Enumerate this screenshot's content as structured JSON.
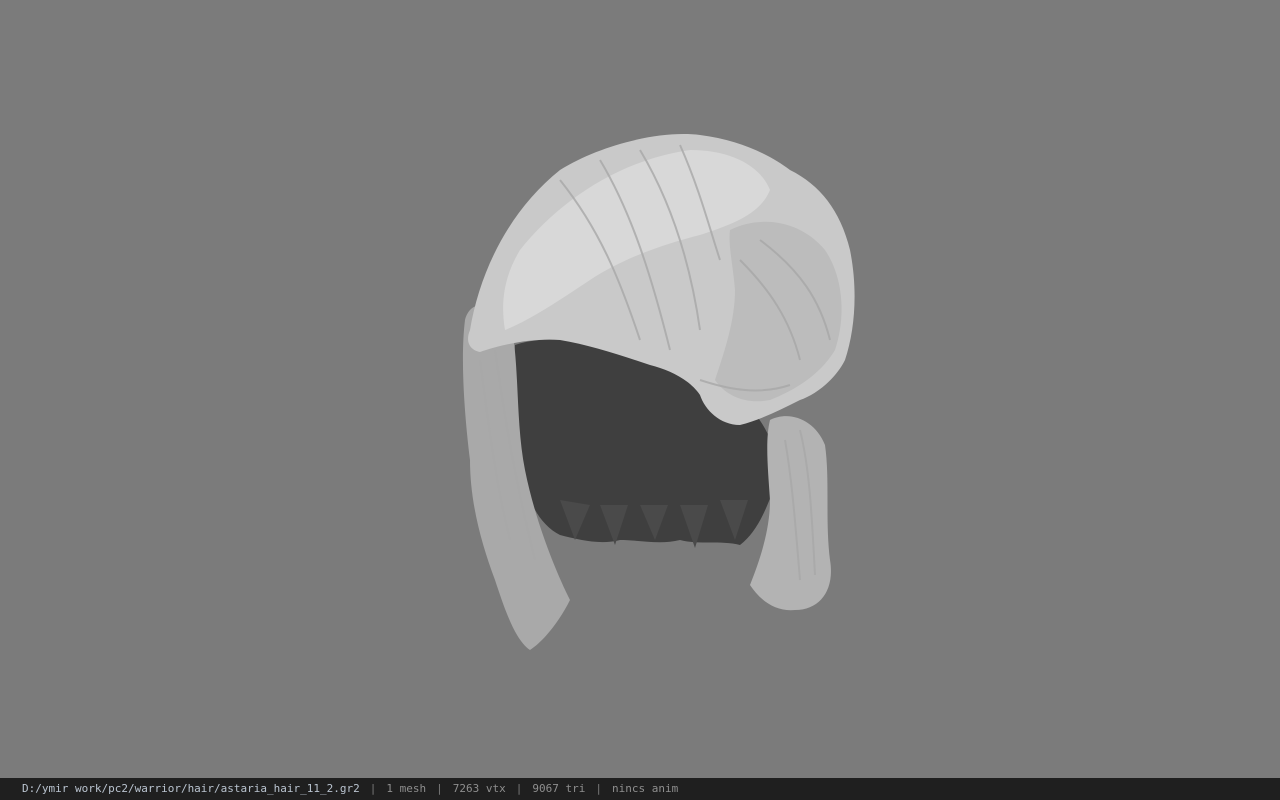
{
  "window": {
    "title": "",
    "background_color": "#7b7b7b"
  },
  "viewport": {
    "model_name": "hair-mesh-render",
    "model_color": "#c9c9c9",
    "model_shadow_color": "#3f3f3f"
  },
  "statusbar": {
    "path": "D:/ymir work/pc2/warrior/hair/astaria_hair_11_2.gr2",
    "mesh_count": "1 mesh",
    "vertex_count": "7263 vtx",
    "triangle_count": "9067 tri",
    "anim_status": "nincs anim",
    "separator": "|"
  }
}
